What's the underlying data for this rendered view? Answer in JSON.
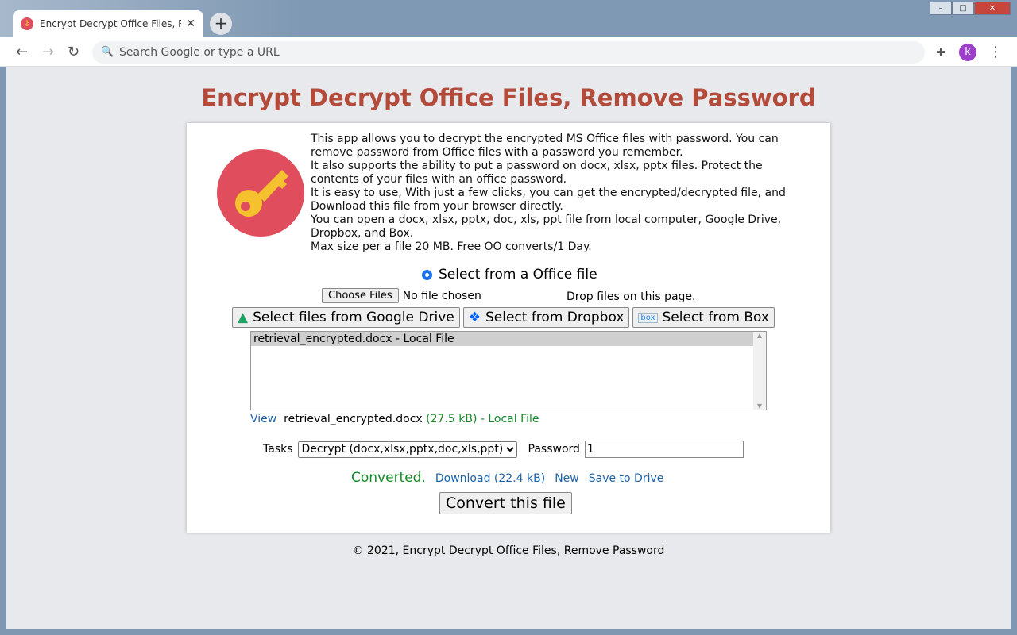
{
  "browser": {
    "tab_title": "Encrypt Decrypt Office Files, Remove Password",
    "omnibox_placeholder": "Search Google or type a URL",
    "avatar_letter": "k"
  },
  "page": {
    "title": "Encrypt Decrypt Office Files, Remove Password",
    "description": [
      "This app allows you to decrypt the encrypted MS Office files with password. You can remove password from Office files with a password you remember.",
      "It also supports the ability to put a password on docx, xlsx, pptx files. Protect the contents of your files with an office password.",
      "It is easy to use, With just a few clicks, you can get the encrypted/decrypted file, and Download this file from your browser directly.",
      "You can open a docx, xlsx, pptx, doc, xls, ppt file from local computer, Google Drive, Dropbox, and Box.",
      "Max size per a file 20 MB. Free OO converts/1 Day."
    ],
    "radio_label": "Select from a Office file",
    "choose_files": "Choose Files",
    "no_file": "No file chosen",
    "drop_hint": "Drop files on this page.",
    "google_drive": "Select files from Google Drive",
    "dropbox": "Select from Dropbox",
    "box": "Select from Box",
    "file_list": [
      "retrieval_encrypted.docx - Local File"
    ],
    "view": "View",
    "file_name": "retrieval_encrypted.docx",
    "file_size": "(27.5 kB) - Local File",
    "tasks_label": "Tasks",
    "task_selected": "Decrypt (docx,xlsx,pptx,doc,xls,ppt)",
    "password_label": "Password",
    "password_value": "1",
    "status": "Converted.",
    "download": "Download (22.4 kB)",
    "new": "New",
    "save_drive": "Save to Drive",
    "convert": "Convert this file",
    "footer": "© 2021, Encrypt Decrypt Office Files, Remove Password"
  }
}
